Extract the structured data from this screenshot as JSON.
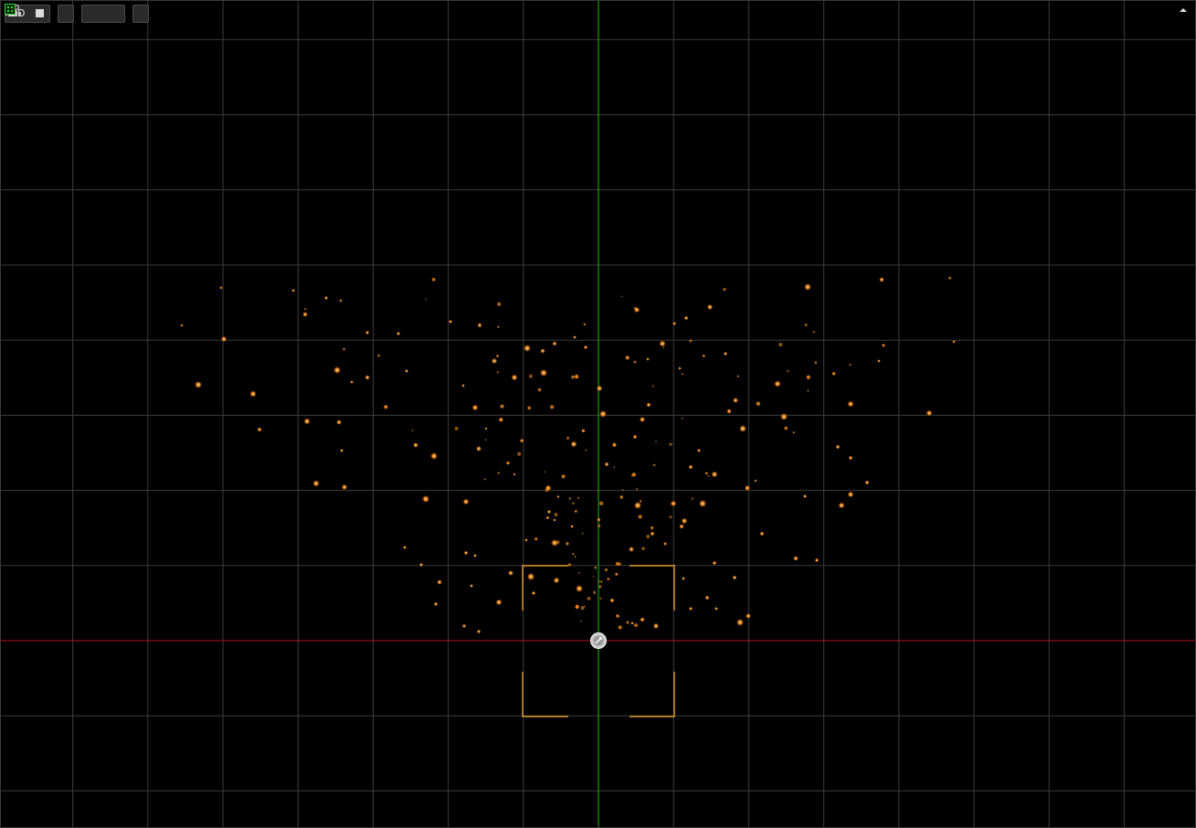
{
  "toolbar": {
    "view_mode_label": "2D",
    "buttons": [
      {
        "name": "view-mode-2d",
        "label": "2D",
        "icon": "square-icon"
      },
      {
        "name": "split-view",
        "icon": "split-view-icon"
      },
      {
        "name": "gizmo-toggle",
        "icon": "camera-gizmo-icon"
      },
      {
        "name": "grid-snap-toggle",
        "icon": "grid-snap-icon"
      }
    ]
  },
  "scene": {
    "grid_color": "#3c3c3c",
    "x_axis_color": "#b0152a",
    "y_axis_color": "#18c018",
    "particle_color": "#e8861e",
    "bracket_color": "#e0992f",
    "origin_icon": "origin-handle-icon"
  }
}
